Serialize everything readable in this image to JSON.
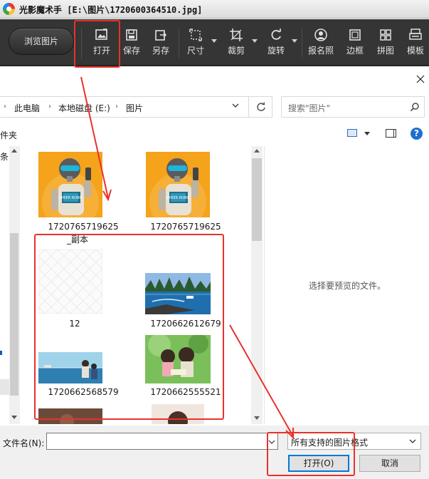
{
  "app": {
    "title": "光影魔术手 [E:\\图片\\1720600364510.jpg]"
  },
  "toolbar": {
    "browse_label": "浏览图片",
    "tools": [
      {
        "label": "打开",
        "icon": "open-image-icon"
      },
      {
        "label": "保存",
        "icon": "save-icon"
      },
      {
        "label": "另存",
        "icon": "save-as-icon"
      },
      {
        "label": "尺寸",
        "icon": "resize-icon"
      },
      {
        "label": "裁剪",
        "icon": "crop-icon"
      },
      {
        "label": "旋转",
        "icon": "rotate-icon"
      },
      {
        "label": "报名照",
        "icon": "id-photo-icon"
      },
      {
        "label": "边框",
        "icon": "frame-icon"
      },
      {
        "label": "拼图",
        "icon": "collage-icon"
      },
      {
        "label": "模板",
        "icon": "template-icon"
      }
    ]
  },
  "dialog": {
    "breadcrumb": [
      "此电脑",
      "本地磁盘 (E:)",
      "图片"
    ],
    "search_placeholder": "搜索\"图片\"",
    "cmd_left_fragment": "件夹",
    "nav_fragment": "条",
    "preview_hint": "选择要预览的文件。",
    "files": [
      {
        "name": "1720765719625_副本",
        "name_line2": "_副本",
        "name_line1": "1720765719625"
      },
      {
        "name": "1720765719625"
      },
      {
        "name": "12"
      },
      {
        "name": "1720662612679"
      },
      {
        "name": "1720662568579"
      },
      {
        "name": "1720662555521"
      }
    ],
    "filename_label": "文件名(N):",
    "filename_value": "",
    "filetype_value": "所有支持的图片格式",
    "open_label": "打开(O)",
    "cancel_label": "取消"
  },
  "colors": {
    "annotation_red": "#e8322b",
    "toolbar_bg": "#353535",
    "accent_blue": "#0078d7"
  }
}
